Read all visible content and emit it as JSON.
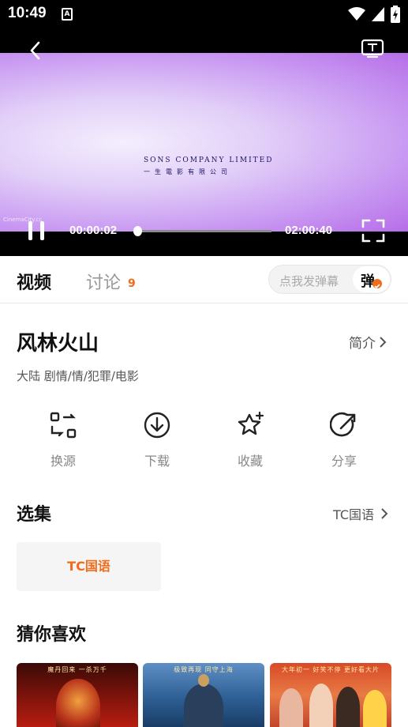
{
  "status_bar": {
    "time": "10:49",
    "sim_label": "A"
  },
  "video": {
    "overlay_line1": "SONS COMPANY LIMITED",
    "overlay_line2": "一生電影有限公司",
    "watermark": "CinemaCity.cc",
    "current_time": "00:00:02",
    "total_time": "02:00:40",
    "progress_fraction": 0.0003
  },
  "tabs": {
    "video": "视频",
    "discuss": "讨论",
    "discuss_count": "9"
  },
  "danmaku": {
    "placeholder": "点我发弹幕",
    "button": "弹"
  },
  "movie": {
    "title": "风林火山",
    "intro_label": "简介",
    "meta": "大陆  剧情/情/犯罪/电影"
  },
  "actions": [
    {
      "label": "换源",
      "icon": "swap-source-icon"
    },
    {
      "label": "下载",
      "icon": "download-icon"
    },
    {
      "label": "收藏",
      "icon": "favorite-star-icon"
    },
    {
      "label": "分享",
      "icon": "share-icon"
    }
  ],
  "episodes": {
    "title": "选集",
    "source": "TC国语",
    "items": [
      "TC国语"
    ]
  },
  "recommend": {
    "title": "猜你喜欢",
    "posters": [
      {
        "top_text": "魔丹回来 一杀万千"
      },
      {
        "top_text": "极致再现 同守上海"
      },
      {
        "top_text": "大年初一 好笑不停 更好看大片"
      }
    ]
  },
  "colors": {
    "accent": "#f06b1a"
  }
}
